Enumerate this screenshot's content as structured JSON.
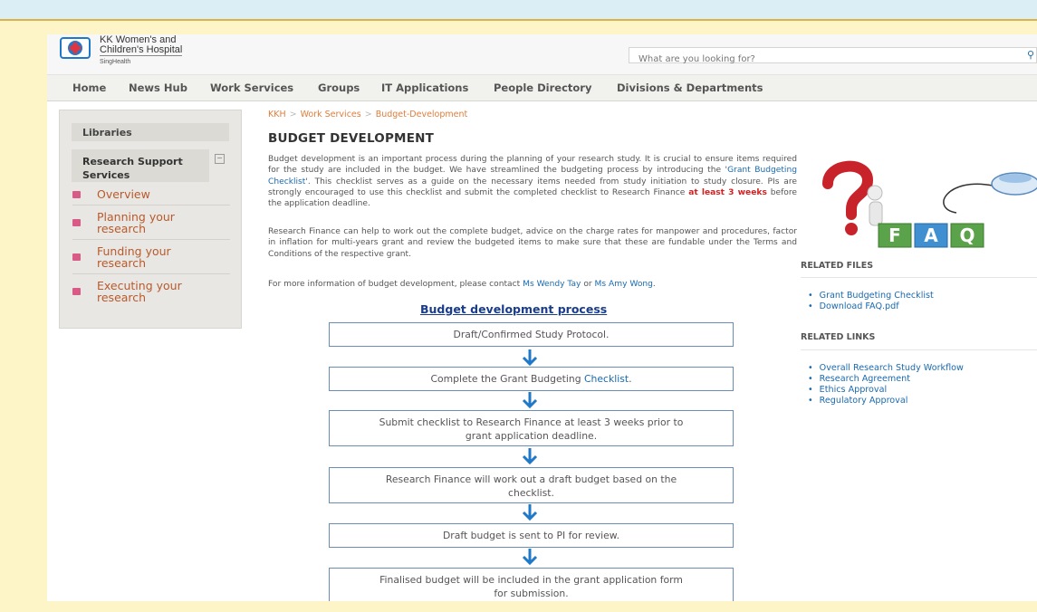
{
  "site": {
    "logo_line1": "KK Women's and",
    "logo_line2": "Children's Hospital",
    "logo_sub": "SingHealth",
    "search_placeholder": "What are you looking for?"
  },
  "nav": [
    "Home",
    "News Hub",
    "Work Services",
    "Groups",
    "IT Applications",
    "People Directory",
    "Divisions & Departments"
  ],
  "sidebar": {
    "libraries": "Libraries",
    "section_line1": "Research Support",
    "section_line2": "Services",
    "items": [
      {
        "line1": "Overview",
        "line2": ""
      },
      {
        "line1": "Planning your",
        "line2": "research"
      },
      {
        "line1": "Funding your",
        "line2": "research"
      },
      {
        "line1": "Executing your",
        "line2": "research"
      }
    ]
  },
  "breadcrumb": [
    "KKH",
    "Work Services",
    "Budget-Development"
  ],
  "page_title": "BUDGET DEVELOPMENT",
  "paragraphs": {
    "p1_a": "Budget development is an important process during the planning of your research study. It is crucial to ensure items required for the study are included in the budget. We have streamlined the budgeting process by introducing the '",
    "p1_link": "Grant Budgeting Checklist",
    "p1_b": "'. This checklist serves as a guide on the necessary items needed from study initiation to study closure. PIs are strongly encouraged to use this checklist and submit the completed checklist to Research Finance ",
    "p1_red": "at least 3 weeks",
    "p1_c": " before the application deadline.",
    "p2": "Research Finance can help to work out the complete budget, advice on the charge rates for manpower and procedures, factor in inflation for multi-years grant and review the budgeted items to make sure that these are fundable under the Terms and Conditions of the respective grant.",
    "p3_a": "For more information of budget development, please contact ",
    "p3_link1": "Ms Wendy Tay",
    "p3_mid": " or ",
    "p3_link2": "Ms Amy Wong",
    "p3_end": "."
  },
  "process": {
    "title": "Budget development process",
    "step1": "Draft/Confirmed Study Protocol.",
    "step2_a": "Complete the Grant Budgeting ",
    "step2_link": "Checklist",
    "step2_b": ".",
    "step3_line1": "Submit checklist to Research Finance at least 3 weeks prior to",
    "step3_line2": "grant application deadline.",
    "step4_line1": "Research Finance will work out a draft budget based on the",
    "step4_line2": "checklist.",
    "step5": "Draft budget is sent to PI for review.",
    "step6_line1": "Finalised budget will be included in the grant application form",
    "step6_line2": "for submission."
  },
  "faq_letters": [
    "F",
    "A",
    "Q"
  ],
  "related_files": {
    "heading": "RELATED FILES",
    "items": [
      "Grant Budgeting Checklist",
      "Download FAQ.pdf"
    ]
  },
  "related_links": {
    "heading": "RELATED LINKS",
    "items": [
      "Overall Research Study Workflow",
      "Research Agreement",
      "Ethics Approval",
      "Regulatory Approval"
    ]
  },
  "colors": {
    "accent_orange": "#e07d3a",
    "link_blue": "#1a6ab0",
    "arrow_blue": "#1f78c8",
    "highlight_red": "#d42020"
  }
}
